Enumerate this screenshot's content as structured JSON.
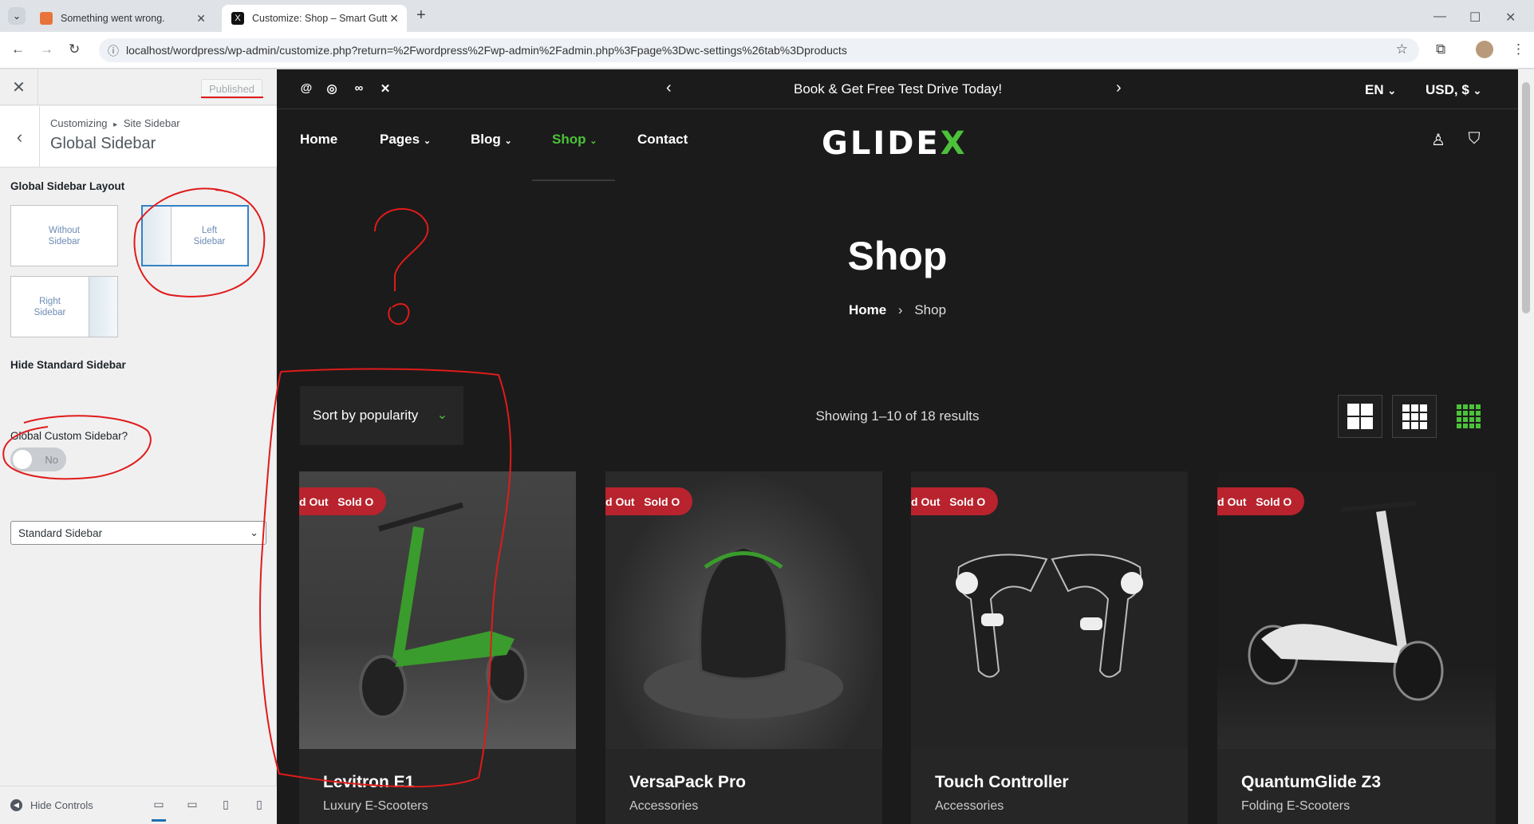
{
  "browser": {
    "tabs": [
      {
        "title": "Something went wrong.",
        "favicon_color": "#e8743b"
      },
      {
        "title": "Customize: Shop – Smart Gutter",
        "favicon_color": "#111111"
      }
    ],
    "url": "localhost/wordpress/wp-admin/customize.php?return=%2Fwordpress%2Fwp-admin%2Fadmin.php%3Fpage%3Dwc-settings%26tab%3Dproducts"
  },
  "customizer": {
    "published_label": "Published",
    "breadcrumb_root": "Customizing",
    "breadcrumb_sep": "▸",
    "breadcrumb_section": "Site Sidebar",
    "panel_title": "Global Sidebar",
    "layout_label": "Global Sidebar Layout",
    "layout_options": [
      {
        "label": "Without Sidebar",
        "selected": false
      },
      {
        "label": "Left Sidebar",
        "selected": true
      },
      {
        "label": "Right Sidebar",
        "selected": false
      }
    ],
    "hide_standard_label": "Hide Standard Sidebar",
    "hide_standard_value": "No",
    "custom_sidebar_label": "Global Custom Sidebar?",
    "custom_sidebar_value": "Standard Sidebar",
    "hide_controls_label": "Hide Controls"
  },
  "site": {
    "promo_text": "Book & Get Free Test Drive Today!",
    "language": "EN",
    "currency": "USD, $",
    "nav": [
      {
        "label": "Home",
        "has_menu": false,
        "active": false
      },
      {
        "label": "Pages",
        "has_menu": true,
        "active": false
      },
      {
        "label": "Blog",
        "has_menu": true,
        "active": false
      },
      {
        "label": "Shop",
        "has_menu": true,
        "active": true
      },
      {
        "label": "Contact",
        "has_menu": false,
        "active": false
      }
    ],
    "logo_text": "GLIDE",
    "logo_accent": "X",
    "accent_color": "#4cc23a",
    "page_title": "Shop",
    "breadcrumb_home": "Home",
    "breadcrumb_sep": "›",
    "breadcrumb_current": "Shop",
    "sort_label": "Sort by popularity",
    "result_count": "Showing 1–10 of 18 results",
    "products": [
      {
        "name": "Levitron E1",
        "category": "Luxury E-Scooters",
        "badge": "d Out   Sold O"
      },
      {
        "name": "VersaPack Pro",
        "category": "Accessories",
        "badge": "d Out   Sold O"
      },
      {
        "name": "Touch Controller",
        "category": "Accessories",
        "badge": "d Out   Sold O"
      },
      {
        "name": "QuantumGlide Z3",
        "category": "Folding E-Scooters",
        "badge": "d Out   Sold O"
      }
    ]
  }
}
